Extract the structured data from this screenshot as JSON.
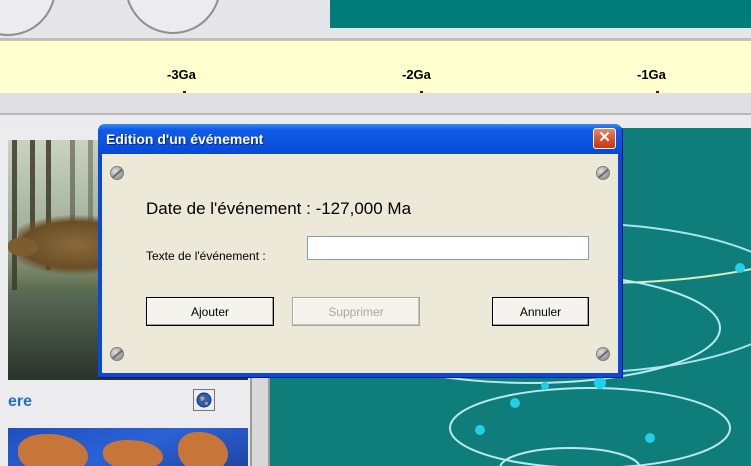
{
  "dialog": {
    "title": "Edition d'un événement",
    "close_glyph": "✕",
    "date_label": "Date de l'événement : -127,000 Ma",
    "text_field_label": "Texte de l'événement :",
    "text_field_value": "",
    "buttons": {
      "add": "Ajouter",
      "delete": "Supprimer",
      "cancel": "Annuler"
    },
    "delete_enabled": false
  },
  "timeline": {
    "ticks": [
      "-3Ga",
      "-2Ga",
      "-1Ga"
    ]
  },
  "left_panel": {
    "title_fragment": "ere",
    "globe_button_icon": "globe-icon"
  },
  "colors": {
    "titlebar": "#0a53e0",
    "timeline_bg": "#ffffcf",
    "orbit_panel_bg": "#0f7d79",
    "panel_title": "#2b6cc4"
  }
}
